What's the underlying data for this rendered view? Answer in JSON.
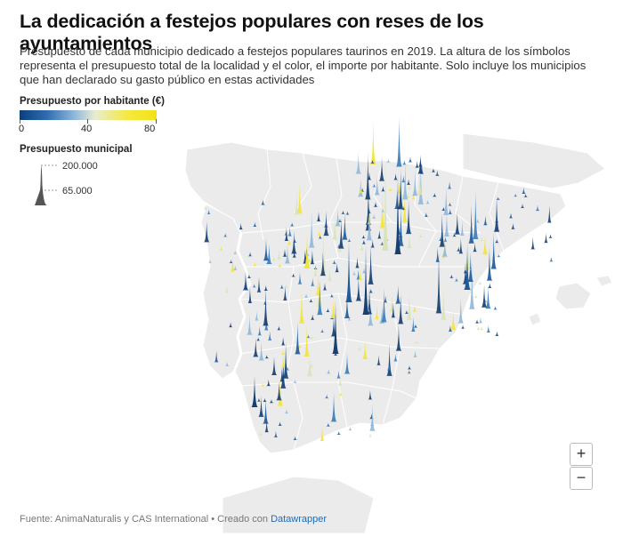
{
  "header": {
    "title": "La dedicación a festejos populares con reses de los ayuntamientos",
    "subtitle": "Presupuesto de cada municipio dedicado a festejos populares taurinos en 2019. La altura de los símbolos representa el presupuesto total de la localidad y el color, el importe por habitante. Solo incluye los municipios que han declarado su gasto público en estas actividades"
  },
  "legend": {
    "color_title": "Presupuesto por habitante (€)",
    "color_ticks": [
      "0",
      "40",
      "80"
    ],
    "color_stops": [
      "#0b3f7a",
      "#2f6db0",
      "#8fb8da",
      "#e8ecd0",
      "#f5e93a",
      "#f2e21a"
    ],
    "size_title": "Presupuesto municipal",
    "size_labels": [
      "200.000",
      "65.000"
    ]
  },
  "map": {
    "land_color": "#ebebeb",
    "border_color": "#ffffff",
    "sea_color": "#ffffff",
    "spike_palette": [
      "#163f73",
      "#1f5a9a",
      "#3b7cbb",
      "#8fb8da",
      "#d8e4b8",
      "#f3e535"
    ]
  },
  "controls": {
    "zoom_in": "+",
    "zoom_out": "−"
  },
  "footer": {
    "source": "Fuente: AnimaNaturalis y CAS International • Creado con ",
    "link": "Datawrapper"
  }
}
